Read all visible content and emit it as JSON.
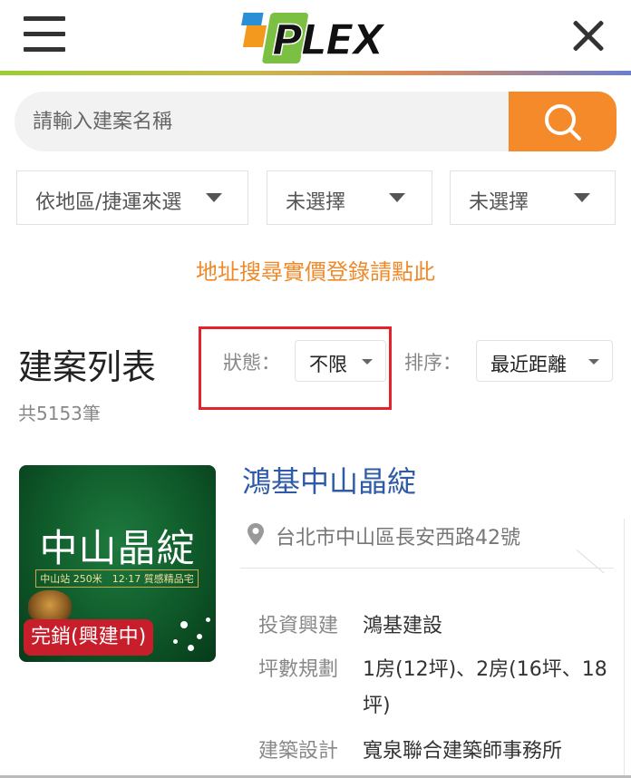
{
  "header": {
    "logo_text": "PLEX",
    "colors": {
      "logo_green": "#7bc043",
      "logo_blue": "#2b8fd6",
      "logo_orange": "#f39a1e",
      "accent_orange": "#f48a2a"
    }
  },
  "search": {
    "placeholder": "請輸入建案名稱",
    "value": ""
  },
  "filters": [
    {
      "label": "依地區/捷運來選"
    },
    {
      "label": "未選擇"
    },
    {
      "label": "未選擇"
    }
  ],
  "address_search_link": "地址搜尋實價登錄請點此",
  "list": {
    "title": "建案列表",
    "count": "共5153筆",
    "status_label": "狀態：",
    "status_value": "不限",
    "sort_label": "排序：",
    "sort_value": "最近距離"
  },
  "listing": {
    "image": {
      "title": "中山晶綻",
      "band_text": "中山站 250米　12‧17 質感精品宅",
      "badge": "完銷(興建中)"
    },
    "name": "鴻基中山晶綻",
    "address": "台北市中山區長安西路42號",
    "details": [
      {
        "label": "投資興建",
        "value": "鴻基建設"
      },
      {
        "label": "坪數規劃",
        "value": "1房(12坪)、2房(16坪、18",
        "value_cont": "坪)"
      },
      {
        "label": "建築設計",
        "value": "寬泉聯合建築師事務所"
      }
    ]
  }
}
